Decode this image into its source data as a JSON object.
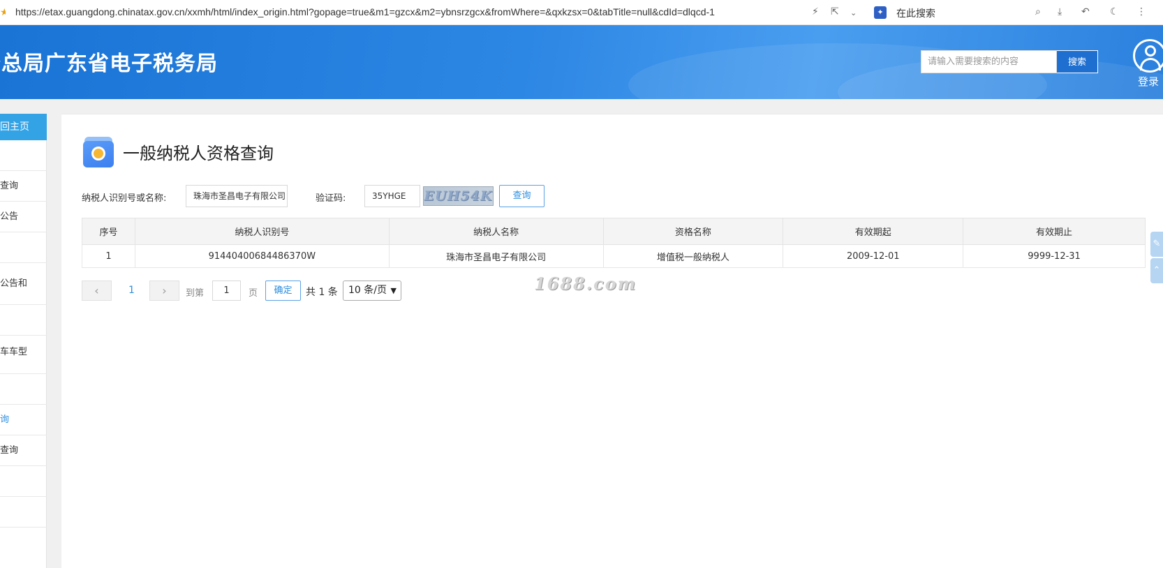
{
  "browser": {
    "url": "https://etax.guangdong.chinatax.gov.cn/xxmh/html/index_origin.html?gopage=true&m1=gzcx&m2=ybnsrzgcx&fromWhere=&qxkzsx=0&tabTitle=null&cdId=dlqcd-1",
    "search_label": "在此搜索"
  },
  "header": {
    "title": "税务总局广东省电子税务局",
    "search_placeholder": "请输入需要搜索的内容",
    "search_button": "搜索",
    "login_label": "登录"
  },
  "sidebar": {
    "home_label": "返回主页",
    "items": [
      {
        "label": ""
      },
      {
        "label": "查询"
      },
      {
        "label": "公告"
      },
      {
        "label": ""
      },
      {
        "label": "公告和"
      },
      {
        "label": ""
      },
      {
        "label": "车车型"
      },
      {
        "label": ""
      },
      {
        "label": "询"
      },
      {
        "label": "查询"
      },
      {
        "label": ""
      },
      {
        "label": ""
      }
    ]
  },
  "page": {
    "title": "一般纳税人资格查询",
    "form": {
      "taxpayer_label": "纳税人识别号或名称:",
      "taxpayer_value": "珠海市圣昌电子有限公司",
      "captcha_label": "验证码:",
      "captcha_value": "35YHGE",
      "captcha_image_text": "EUH54K",
      "query_button": "查询"
    },
    "table": {
      "headers": [
        "序号",
        "纳税人识别号",
        "纳税人名称",
        "资格名称",
        "有效期起",
        "有效期止"
      ],
      "rows": [
        [
          "1",
          "91440400684486370W",
          "珠海市圣昌电子有限公司",
          "增值税一般纳税人",
          "2009-12-01",
          "9999-12-31"
        ]
      ]
    },
    "pager": {
      "current_page": "1",
      "goto_label": "到第",
      "goto_value": "1",
      "page_unit": "页",
      "confirm_button": "确定",
      "total_text": "共 1 条",
      "page_size": "10 条/页"
    },
    "watermark": "1688.com"
  }
}
